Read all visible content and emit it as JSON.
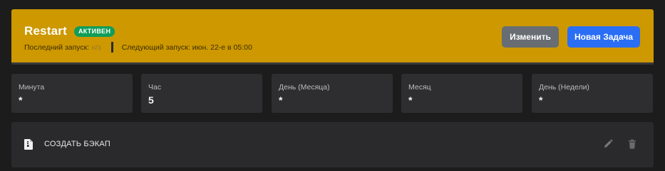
{
  "header": {
    "title": "Restart",
    "status_badge": "АКТИВЕН",
    "last_run_label": "Последний запуск:",
    "last_run_value": "н/з",
    "next_run_text": "Следующий запуск: июн. 22-е в 05:00",
    "edit_button": "Изменить",
    "new_task_button": "Новая Задача",
    "background_color": "#cd9800",
    "badge_color": "#0f9d58",
    "primary_button_color": "#2a6ef5"
  },
  "schedule": [
    {
      "label": "Минута",
      "value": "*"
    },
    {
      "label": "Час",
      "value": "5"
    },
    {
      "label": "День (Месяца)",
      "value": "*"
    },
    {
      "label": "Месяц",
      "value": "*"
    },
    {
      "label": "День (Недели)",
      "value": "*"
    }
  ],
  "tasks": [
    {
      "icon": "file-archive-icon",
      "label": "СОЗДАТЬ БЭКАП",
      "edit_icon": "pencil-icon",
      "delete_icon": "trash-icon"
    }
  ]
}
